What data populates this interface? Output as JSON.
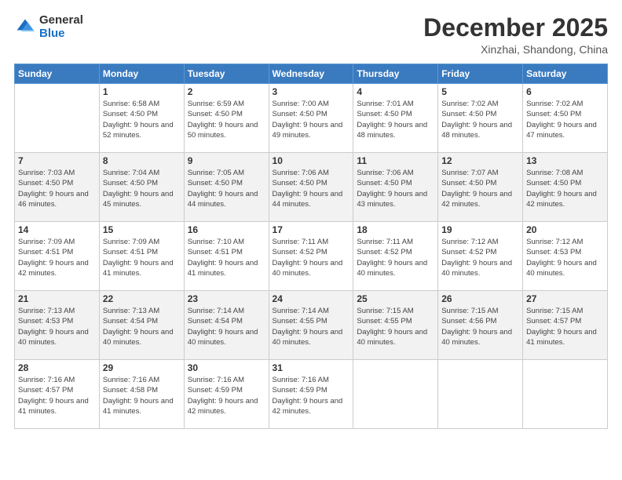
{
  "header": {
    "logo_general": "General",
    "logo_blue": "Blue",
    "month": "December 2025",
    "location": "Xinzhai, Shandong, China"
  },
  "days_of_week": [
    "Sunday",
    "Monday",
    "Tuesday",
    "Wednesday",
    "Thursday",
    "Friday",
    "Saturday"
  ],
  "weeks": [
    [
      {
        "day": "",
        "sunrise": "",
        "sunset": "",
        "daylight": ""
      },
      {
        "day": "1",
        "sunrise": "Sunrise: 6:58 AM",
        "sunset": "Sunset: 4:50 PM",
        "daylight": "Daylight: 9 hours and 52 minutes."
      },
      {
        "day": "2",
        "sunrise": "Sunrise: 6:59 AM",
        "sunset": "Sunset: 4:50 PM",
        "daylight": "Daylight: 9 hours and 50 minutes."
      },
      {
        "day": "3",
        "sunrise": "Sunrise: 7:00 AM",
        "sunset": "Sunset: 4:50 PM",
        "daylight": "Daylight: 9 hours and 49 minutes."
      },
      {
        "day": "4",
        "sunrise": "Sunrise: 7:01 AM",
        "sunset": "Sunset: 4:50 PM",
        "daylight": "Daylight: 9 hours and 48 minutes."
      },
      {
        "day": "5",
        "sunrise": "Sunrise: 7:02 AM",
        "sunset": "Sunset: 4:50 PM",
        "daylight": "Daylight: 9 hours and 48 minutes."
      },
      {
        "day": "6",
        "sunrise": "Sunrise: 7:02 AM",
        "sunset": "Sunset: 4:50 PM",
        "daylight": "Daylight: 9 hours and 47 minutes."
      }
    ],
    [
      {
        "day": "7",
        "sunrise": "Sunrise: 7:03 AM",
        "sunset": "Sunset: 4:50 PM",
        "daylight": "Daylight: 9 hours and 46 minutes."
      },
      {
        "day": "8",
        "sunrise": "Sunrise: 7:04 AM",
        "sunset": "Sunset: 4:50 PM",
        "daylight": "Daylight: 9 hours and 45 minutes."
      },
      {
        "day": "9",
        "sunrise": "Sunrise: 7:05 AM",
        "sunset": "Sunset: 4:50 PM",
        "daylight": "Daylight: 9 hours and 44 minutes."
      },
      {
        "day": "10",
        "sunrise": "Sunrise: 7:06 AM",
        "sunset": "Sunset: 4:50 PM",
        "daylight": "Daylight: 9 hours and 44 minutes."
      },
      {
        "day": "11",
        "sunrise": "Sunrise: 7:06 AM",
        "sunset": "Sunset: 4:50 PM",
        "daylight": "Daylight: 9 hours and 43 minutes."
      },
      {
        "day": "12",
        "sunrise": "Sunrise: 7:07 AM",
        "sunset": "Sunset: 4:50 PM",
        "daylight": "Daylight: 9 hours and 42 minutes."
      },
      {
        "day": "13",
        "sunrise": "Sunrise: 7:08 AM",
        "sunset": "Sunset: 4:50 PM",
        "daylight": "Daylight: 9 hours and 42 minutes."
      }
    ],
    [
      {
        "day": "14",
        "sunrise": "Sunrise: 7:09 AM",
        "sunset": "Sunset: 4:51 PM",
        "daylight": "Daylight: 9 hours and 42 minutes."
      },
      {
        "day": "15",
        "sunrise": "Sunrise: 7:09 AM",
        "sunset": "Sunset: 4:51 PM",
        "daylight": "Daylight: 9 hours and 41 minutes."
      },
      {
        "day": "16",
        "sunrise": "Sunrise: 7:10 AM",
        "sunset": "Sunset: 4:51 PM",
        "daylight": "Daylight: 9 hours and 41 minutes."
      },
      {
        "day": "17",
        "sunrise": "Sunrise: 7:11 AM",
        "sunset": "Sunset: 4:52 PM",
        "daylight": "Daylight: 9 hours and 40 minutes."
      },
      {
        "day": "18",
        "sunrise": "Sunrise: 7:11 AM",
        "sunset": "Sunset: 4:52 PM",
        "daylight": "Daylight: 9 hours and 40 minutes."
      },
      {
        "day": "19",
        "sunrise": "Sunrise: 7:12 AM",
        "sunset": "Sunset: 4:52 PM",
        "daylight": "Daylight: 9 hours and 40 minutes."
      },
      {
        "day": "20",
        "sunrise": "Sunrise: 7:12 AM",
        "sunset": "Sunset: 4:53 PM",
        "daylight": "Daylight: 9 hours and 40 minutes."
      }
    ],
    [
      {
        "day": "21",
        "sunrise": "Sunrise: 7:13 AM",
        "sunset": "Sunset: 4:53 PM",
        "daylight": "Daylight: 9 hours and 40 minutes."
      },
      {
        "day": "22",
        "sunrise": "Sunrise: 7:13 AM",
        "sunset": "Sunset: 4:54 PM",
        "daylight": "Daylight: 9 hours and 40 minutes."
      },
      {
        "day": "23",
        "sunrise": "Sunrise: 7:14 AM",
        "sunset": "Sunset: 4:54 PM",
        "daylight": "Daylight: 9 hours and 40 minutes."
      },
      {
        "day": "24",
        "sunrise": "Sunrise: 7:14 AM",
        "sunset": "Sunset: 4:55 PM",
        "daylight": "Daylight: 9 hours and 40 minutes."
      },
      {
        "day": "25",
        "sunrise": "Sunrise: 7:15 AM",
        "sunset": "Sunset: 4:55 PM",
        "daylight": "Daylight: 9 hours and 40 minutes."
      },
      {
        "day": "26",
        "sunrise": "Sunrise: 7:15 AM",
        "sunset": "Sunset: 4:56 PM",
        "daylight": "Daylight: 9 hours and 40 minutes."
      },
      {
        "day": "27",
        "sunrise": "Sunrise: 7:15 AM",
        "sunset": "Sunset: 4:57 PM",
        "daylight": "Daylight: 9 hours and 41 minutes."
      }
    ],
    [
      {
        "day": "28",
        "sunrise": "Sunrise: 7:16 AM",
        "sunset": "Sunset: 4:57 PM",
        "daylight": "Daylight: 9 hours and 41 minutes."
      },
      {
        "day": "29",
        "sunrise": "Sunrise: 7:16 AM",
        "sunset": "Sunset: 4:58 PM",
        "daylight": "Daylight: 9 hours and 41 minutes."
      },
      {
        "day": "30",
        "sunrise": "Sunrise: 7:16 AM",
        "sunset": "Sunset: 4:59 PM",
        "daylight": "Daylight: 9 hours and 42 minutes."
      },
      {
        "day": "31",
        "sunrise": "Sunrise: 7:16 AM",
        "sunset": "Sunset: 4:59 PM",
        "daylight": "Daylight: 9 hours and 42 minutes."
      },
      {
        "day": "",
        "sunrise": "",
        "sunset": "",
        "daylight": ""
      },
      {
        "day": "",
        "sunrise": "",
        "sunset": "",
        "daylight": ""
      },
      {
        "day": "",
        "sunrise": "",
        "sunset": "",
        "daylight": ""
      }
    ]
  ]
}
